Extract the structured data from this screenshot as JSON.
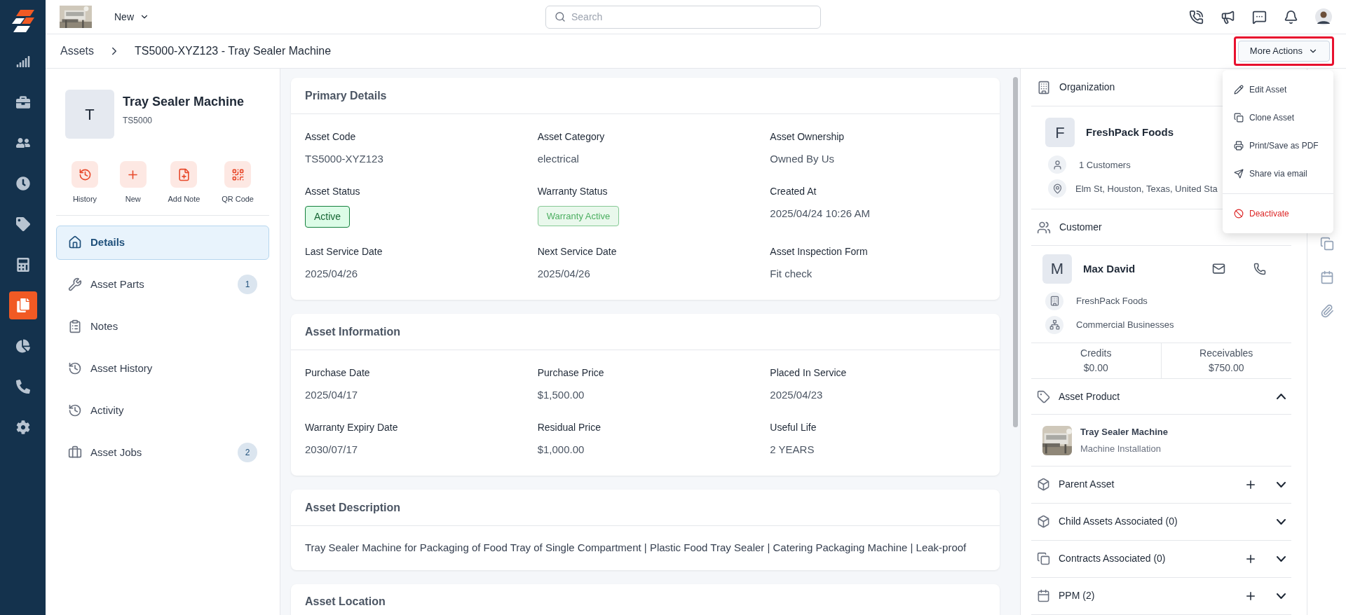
{
  "nav": {
    "items": [
      {
        "selected": false
      },
      {
        "selected": false
      },
      {
        "selected": false
      },
      {
        "selected": false
      },
      {
        "selected": false
      },
      {
        "selected": false
      },
      {
        "selected": true
      },
      {
        "selected": false
      },
      {
        "selected": false
      },
      {
        "selected": false
      }
    ]
  },
  "top_bar": {
    "menu_label": "New",
    "search": {
      "placeholder": "Search"
    }
  },
  "breadcrumb": [
    "Assets",
    "TS5000-XYZ123 - Tray Sealer Machine"
  ],
  "more_actions": {
    "label": "More Actions",
    "highlighted": true,
    "menu": [
      {
        "label": "Edit Asset",
        "kind": "edit"
      },
      {
        "label": "Clone Asset",
        "kind": "clone"
      },
      {
        "label": "Print/Save as PDF",
        "kind": "print"
      },
      {
        "label": "Share via email",
        "kind": "share"
      },
      {
        "label": "Deactivate",
        "kind": "danger"
      }
    ]
  },
  "asset": {
    "initial": "T",
    "name": "Tray Sealer Machine",
    "code": "TS5000"
  },
  "quick_actions": [
    {
      "label": "History",
      "kind": "history"
    },
    {
      "label": "New",
      "kind": "new"
    },
    {
      "label": "Add Note",
      "kind": "note"
    },
    {
      "label": "QR Code",
      "kind": "qr"
    }
  ],
  "tabs": [
    {
      "label": "Details",
      "kind": "home",
      "selected": true
    },
    {
      "label": "Asset Parts",
      "kind": "wrench",
      "selected": false,
      "count": "1"
    },
    {
      "label": "Notes",
      "kind": "clipboard",
      "selected": false
    },
    {
      "label": "Asset History",
      "kind": "history",
      "selected": false
    },
    {
      "label": "Activity",
      "kind": "history",
      "selected": false
    },
    {
      "label": "Asset Jobs",
      "kind": "briefcase",
      "selected": false,
      "count": "2"
    }
  ],
  "sections": [
    {
      "title": "Primary Details",
      "fields": [
        {
          "label": "Asset Code",
          "value": "TS5000-XYZ123"
        },
        {
          "label": "Asset Category",
          "value": "electrical"
        },
        {
          "label": "Asset Ownership",
          "value": "Owned By Us"
        },
        {
          "label": "Asset Status",
          "value": "Active",
          "kind": "status"
        },
        {
          "label": "Warranty Status",
          "value": "Warranty Active",
          "kind": "status-soft"
        },
        {
          "label": "Created At",
          "value": "2025/04/24 10:26 AM"
        },
        {
          "label": "Last Service Date",
          "value": "2025/04/26"
        },
        {
          "label": "Next Service Date",
          "value": "2025/04/26"
        },
        {
          "label": "Asset Inspection Form",
          "value": "Fit check"
        }
      ]
    },
    {
      "title": "Asset Information",
      "fields": [
        {
          "label": "Purchase Date",
          "value": "2025/04/17"
        },
        {
          "label": "Purchase Price",
          "value": "$1,500.00"
        },
        {
          "label": "Placed In Service",
          "value": "2025/04/23"
        },
        {
          "label": "Warranty Expiry Date",
          "value": "2030/07/17"
        },
        {
          "label": "Residual Price",
          "value": "$1,000.00"
        },
        {
          "label": "Useful Life",
          "value": "2 YEARS"
        }
      ]
    },
    {
      "title": "Asset Description",
      "text": "Tray Sealer Machine for Packaging of Food Tray of Single Compartment | Plastic Food Tray Sealer | Catering Packaging Machine | Leak-proof"
    },
    {
      "title": "Asset Location"
    }
  ],
  "organization": {
    "title": "Organization",
    "initial": "F",
    "name": "FreshPack Foods",
    "customers": "1 Customers",
    "address": "Elm St, Houston, Texas, United Sta"
  },
  "customer": {
    "title": "Customer",
    "initial": "M",
    "name": "Max David",
    "company": "FreshPack Foods",
    "segment": "Commercial Businesses",
    "totals": [
      {
        "label": "Credits",
        "value": "$0.00"
      },
      {
        "label": "Receivables",
        "value": "$750.00"
      }
    ]
  },
  "asset_product": {
    "title": "Asset Product",
    "expanded": true,
    "name": "Tray Sealer Machine",
    "subtitle": "Machine Installation"
  },
  "related": [
    {
      "title": "Parent Asset",
      "kind": "box",
      "addable": true,
      "expanded": false
    },
    {
      "title": "Child Assets Associated (0)",
      "kind": "box",
      "addable": false,
      "expanded": false
    },
    {
      "title": "Contracts Associated (0)",
      "kind": "copy",
      "addable": true,
      "expanded": false
    },
    {
      "title": "PPM (2)",
      "kind": "calendar",
      "addable": true,
      "expanded": false
    }
  ]
}
